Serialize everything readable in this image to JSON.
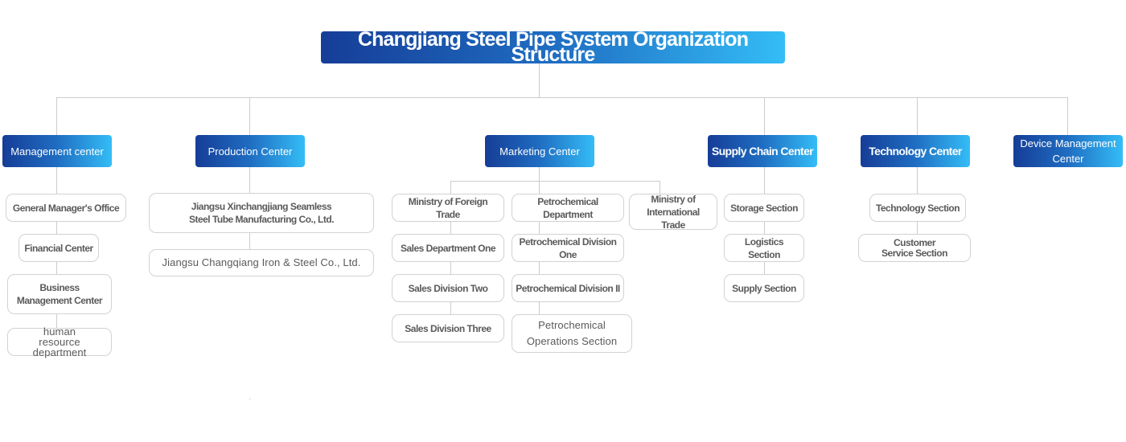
{
  "title": "Changjiang Steel Pipe System Organization Structure",
  "colors": {
    "header_gradient_start": "#163d97",
    "header_gradient_end": "#34bdf6",
    "connector": "#cccccc",
    "box_border": "#d2d2d2",
    "box_text": "#555555"
  },
  "centers": [
    {
      "name": "Management center",
      "units": [
        "General Manager's Office",
        "Financial Center",
        "Business Management Center",
        "human resource department"
      ]
    },
    {
      "name": "Production Center",
      "units": [
        "Jiangsu Xinchangjiang Seamless Steel Tube Manufacturing Co., Ltd.",
        "Jiangsu Changqiang Iron & Steel Co., Ltd."
      ]
    },
    {
      "name": "Marketing Center",
      "branches": [
        {
          "name": "Ministry of Foreign Trade",
          "units": [
            "Sales Department One",
            "Sales Division Two",
            "Sales Division Three"
          ]
        },
        {
          "name": "Petrochemical Department",
          "units": [
            "Petrochemical Division One",
            "Petrochemical Division II",
            "Petrochemical Operations Section"
          ]
        },
        {
          "name": "Ministry of International Trade",
          "units": []
        }
      ]
    },
    {
      "name": "Supply Chain Center",
      "units": [
        "Storage Section",
        "Logistics Section",
        "Supply Section"
      ]
    },
    {
      "name": "Technology Center",
      "units": [
        "Technology Section",
        "Customer Service Section"
      ]
    },
    {
      "name": "Device Management Center",
      "units": []
    }
  ]
}
